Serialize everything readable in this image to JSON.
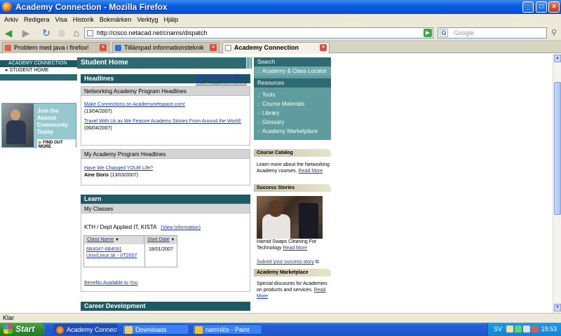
{
  "window": {
    "title": "Academy Connection - Mozilla Firefox"
  },
  "menu": [
    "Arkiv",
    "Redigera",
    "Visa",
    "Historik",
    "Bokmärken",
    "Verktyg",
    "Hjälp"
  ],
  "nav": {
    "url": "http://cisco.netacad.net/cnams/dispatch",
    "search_placeholder": "Google"
  },
  "tabs": [
    {
      "label": "Problem med java i firefox!"
    },
    {
      "label": "Tillämpad informationsteknik"
    },
    {
      "label": "Academy Connection"
    }
  ],
  "left": {
    "header": "ACADEMY CONNECTION",
    "item": "▸ STUDENT HOME",
    "promo_text": "Join the Alumni Community Today",
    "promo_link": "FIND OUT MORE"
  },
  "center": {
    "page_title": "Student Home",
    "headlines": {
      "title": "Headlines",
      "view_recent": "View Recent Headlines",
      "view_archive": "View Headlines Archive",
      "net_title": "Networking Academy Program Headlines",
      "items": [
        {
          "link": "Make Connections on Academynetspace.com!",
          "date": "(13/04/2007)"
        },
        {
          "link": "Travel With Us as We Feature Academy Stories From Around the World!",
          "date": "(06/04/2007)"
        }
      ],
      "my_title": "My Academy Program Headlines",
      "my_item": {
        "link": "Have We Changed YOUR Life?",
        "author": "Aine Doris",
        "date": "(13/03/2007)"
      }
    },
    "learn": {
      "title": "Learn",
      "my_classes": "My Classes",
      "org": "KTH / Dept Applied IT, KISTA",
      "view_info": "(View Information)",
      "col_class": "Class Name",
      "col_start": "Start Date",
      "class_link": "6B4047-6B4091 Unix/Linux sk - VT2007",
      "start_date": "18/01/2007",
      "benefits": "Benefits Available to You"
    },
    "career": {
      "title": "Career Development"
    }
  },
  "right": {
    "search": "Search",
    "locator": "Academy & Class Locator",
    "resources": "Resources",
    "res_items": [
      "Tools",
      "Course Materials",
      "Library",
      "Glossary",
      "Academy Marketplace"
    ],
    "catalog_title": "Course Catalog",
    "catalog_text": "Learn more about the Networking Academy courses.",
    "catalog_link": "Read More",
    "success_title": "Success Stories",
    "success_caption": "Hamid Swaps Cleaning For Technology",
    "success_link": "Read More",
    "submit_link": "Submit your success story",
    "market_title": "Academy Marketplace",
    "market_text": "Special discounts for Academies on products and services.",
    "market_link": "Read More"
  },
  "status": {
    "text": "Klar"
  },
  "taskbar": {
    "start": "Start",
    "tasks": [
      "Academy Connect...",
      "Downloads",
      "namnlös - Paint"
    ],
    "lang": "SV",
    "clock": "19:53"
  }
}
